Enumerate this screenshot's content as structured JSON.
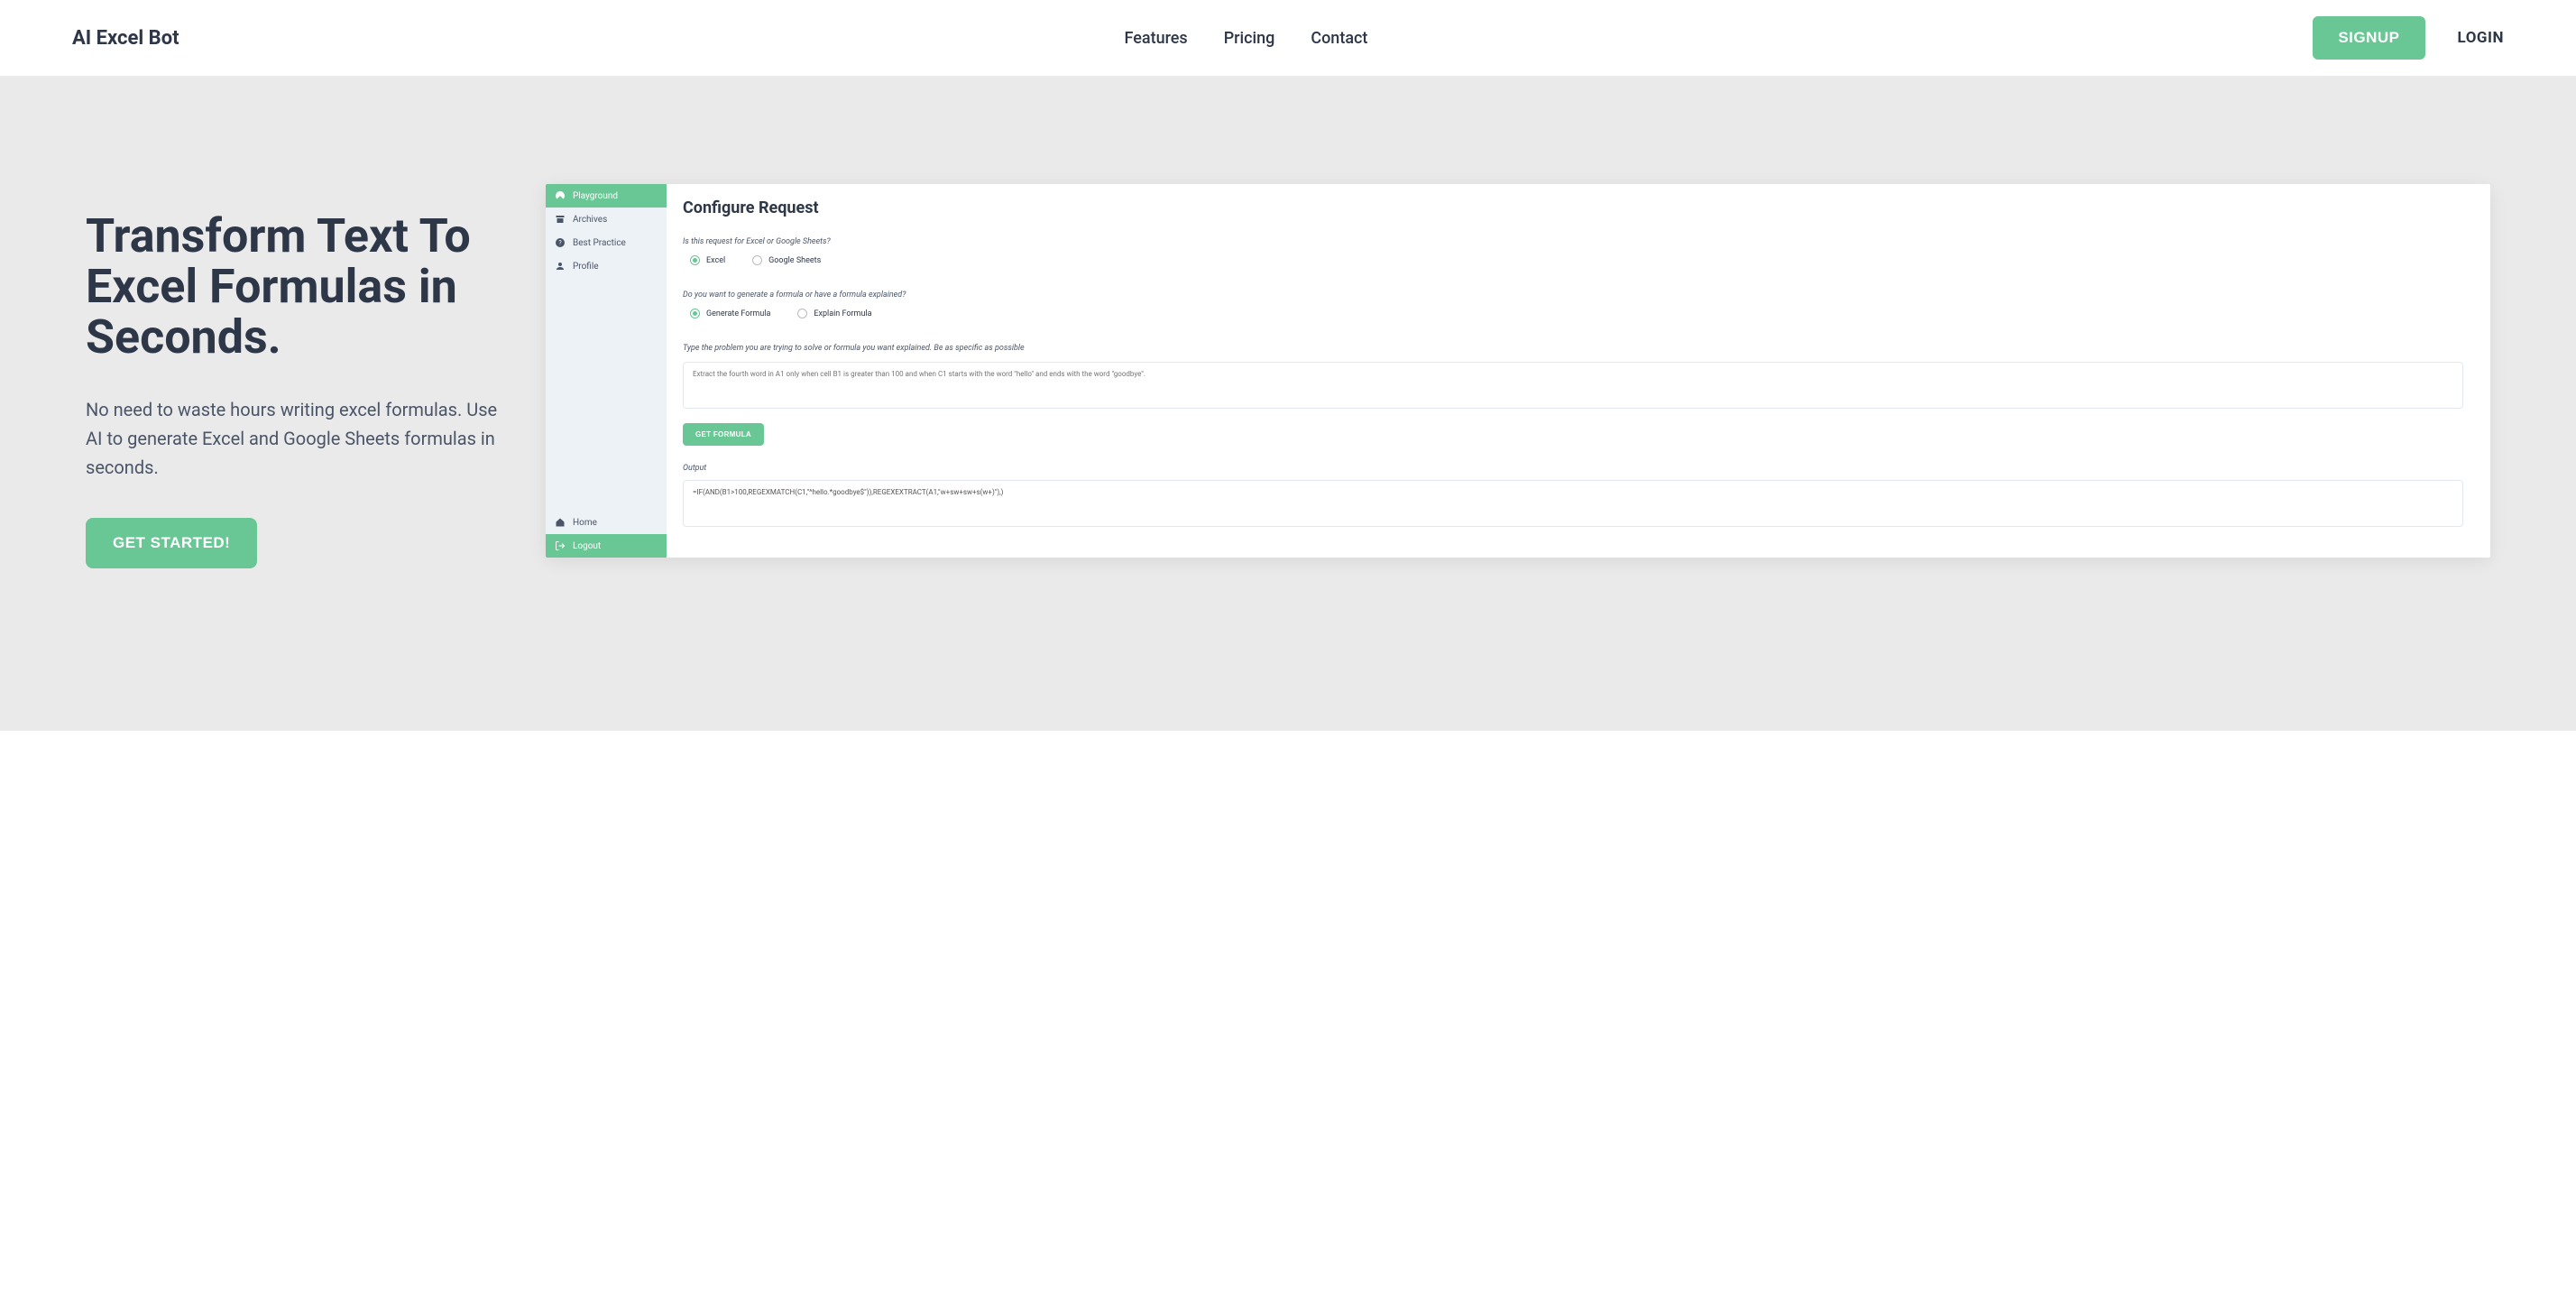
{
  "header": {
    "logo": "AI Excel Bot",
    "nav": {
      "features": "Features",
      "pricing": "Pricing",
      "contact": "Contact"
    },
    "signup": "SIGNUP",
    "login": "LOGIN"
  },
  "hero": {
    "title": "Transform Text To Excel Formulas in Seconds.",
    "subtitle": "No need to waste hours writing excel formulas. Use AI to generate Excel and Google Sheets formulas in seconds.",
    "cta": "GET STARTED!"
  },
  "app": {
    "sidebar": {
      "playground": "Playground",
      "archives": "Archives",
      "best_practice": "Best Practice",
      "profile": "Profile",
      "home": "Home",
      "logout": "Logout"
    },
    "main": {
      "heading": "Configure Request",
      "q1_label": "Is this request for Excel or Google Sheets?",
      "q1_opt1": "Excel",
      "q1_opt2": "Google Sheets",
      "q2_label": "Do you want to generate a formula or have a formula explained?",
      "q2_opt1": "Generate Formula",
      "q2_opt2": "Explain Formula",
      "prompt_label": "Type the problem you are trying to solve or formula you want explained. Be as specific as possible",
      "prompt_placeholder": "Extract the fourth word in A1 only when cell B1 is greater than 100 and when C1 starts with the word \"hello\" and ends with the word \"goodbye\".",
      "get_formula": "GET FORMULA",
      "output_label": "Output",
      "output_value": "=IF(AND(B1>100,REGEXMATCH(C1,\"^hello.*goodbye$\")),REGEXEXTRACT(A1,\"w+sw+sw+s(w+)\"),)"
    }
  }
}
